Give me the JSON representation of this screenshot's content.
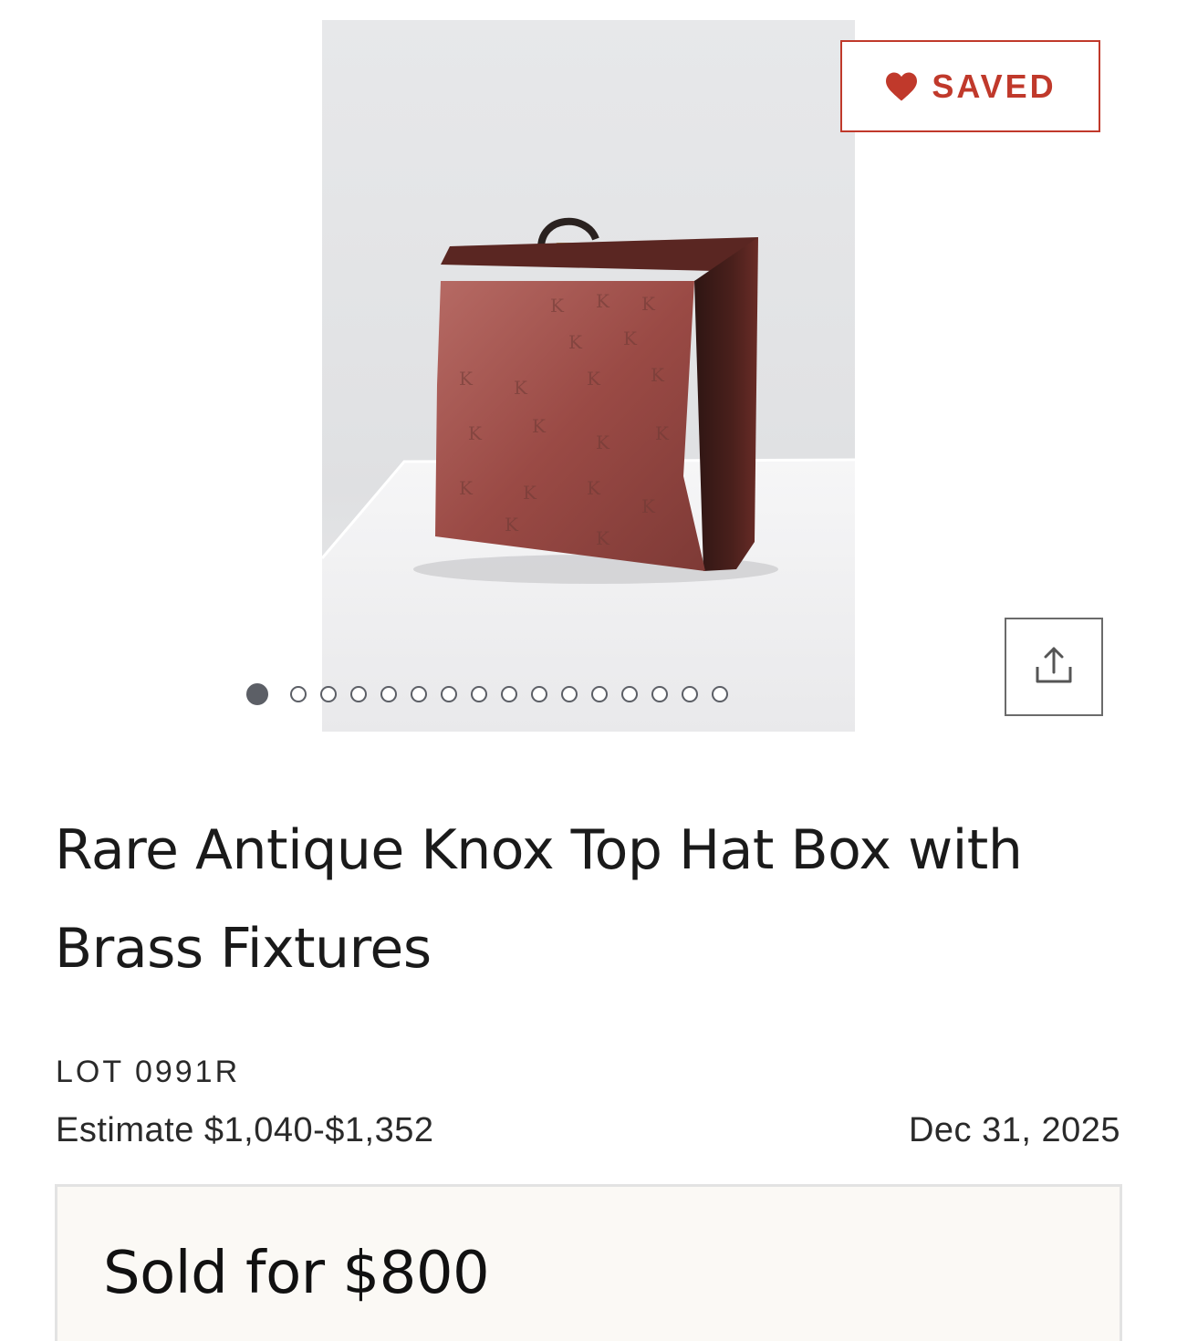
{
  "gallery": {
    "image_alt": "Antique hat box on white pedestal",
    "image_count": 16,
    "active_index": 0
  },
  "saved_button": {
    "label": "SAVED",
    "icon": "heart-icon",
    "color": "#c0392b"
  },
  "share_button": {
    "icon": "share-icon"
  },
  "lot": {
    "title": "Rare Antique Knox Top Hat Box with Brass Fixtures",
    "number": "LOT 0991R",
    "estimate": "Estimate $1,040-$1,352",
    "date": "Dec 31, 2025",
    "result": "Sold for $800"
  },
  "colors": {
    "accent": "#c0392b",
    "panel_background": "#fbf9f5",
    "text": "#1a1a1a"
  }
}
